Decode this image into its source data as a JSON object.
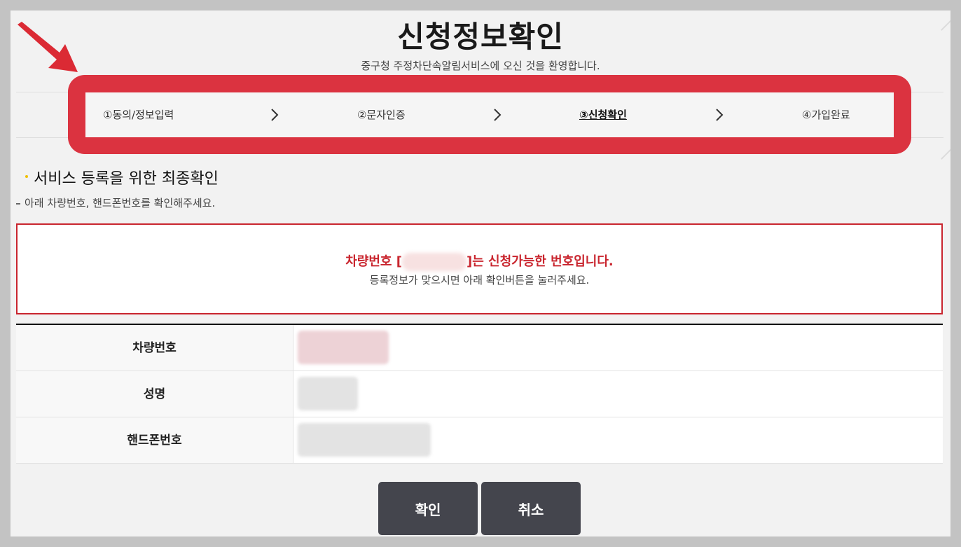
{
  "page": {
    "title": "신청정보확인",
    "subtitle": "중구청 주정차단속알림서비스에 오신 것을 환영합니다."
  },
  "steps": [
    {
      "label": "①동의/정보입력",
      "active": false
    },
    {
      "label": "②문자인증",
      "active": false
    },
    {
      "label": "③신청확인",
      "active": true
    },
    {
      "label": "④가입완료",
      "active": false
    }
  ],
  "section": {
    "title": "서비스 등록을 위한 최종확인",
    "desc": "아래 차량번호, 핸드폰번호를 확인해주세요."
  },
  "notice": {
    "main_prefix": "차량번호 [",
    "main_suffix": "]는 신청가능한 번호입니다.",
    "sub": "등록정보가 맞으시면 아래 확인버튼을 눌러주세요."
  },
  "table": {
    "rows": [
      {
        "label": "차량번호"
      },
      {
        "label": "성명"
      },
      {
        "label": "핸드폰번호"
      }
    ]
  },
  "buttons": {
    "confirm": "확인",
    "cancel": "취소"
  },
  "colors": {
    "highlight": "#db3340",
    "notice_red": "#c9252e",
    "button_bg": "#44454d"
  }
}
